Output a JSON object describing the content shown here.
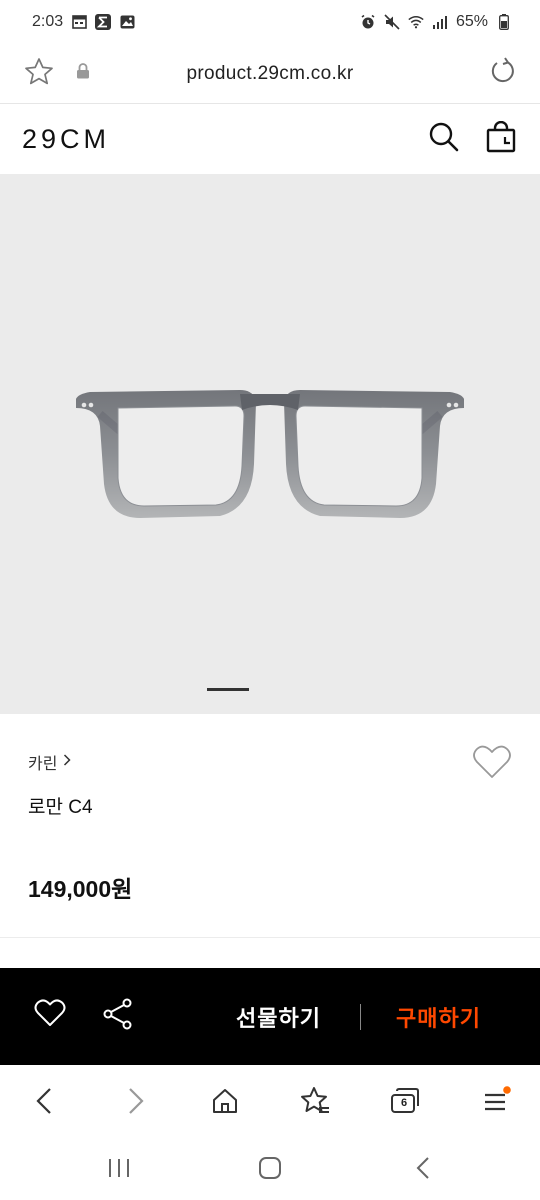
{
  "status_bar": {
    "time": "2:03",
    "battery": "65%",
    "left_icons": [
      "calendar-icon",
      "sigma-app-icon",
      "gallery-icon"
    ],
    "right_icons": [
      "alarm-icon",
      "mute-icon",
      "wifi-icon",
      "signal-icon",
      "battery-icon"
    ]
  },
  "browser": {
    "url": "product.29cm.co.kr",
    "icons": [
      "star-icon",
      "lock-icon",
      "refresh-icon"
    ]
  },
  "header": {
    "logo": "29CM",
    "icons": [
      "search-icon",
      "shopping-bag-icon"
    ]
  },
  "product": {
    "brand": "카린",
    "brand_chevron": ">",
    "name": "로만 C4",
    "price": "149,000원",
    "image_index": 1,
    "image_count": 1,
    "colors": {
      "image_background": "#ebebeb",
      "frame": "#6b6e73"
    }
  },
  "action_bar": {
    "gift_label": "선물하기",
    "buy_label": "구매하기",
    "colors": {
      "background": "#000000",
      "buy": "#ff4800",
      "gift": "#ffffff"
    }
  },
  "toolbar": {
    "tab_count": "6",
    "items": [
      "back-icon",
      "forward-icon",
      "home-icon",
      "bookmarks-icon",
      "tabs-icon",
      "menu-icon"
    ],
    "menu_badge_color": "#ff6a00"
  },
  "android_nav": {
    "items": [
      "recents-icon",
      "home-button-icon",
      "back-icon"
    ]
  }
}
